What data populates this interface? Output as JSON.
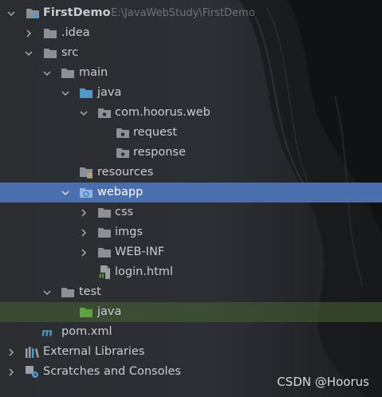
{
  "tree": {
    "project_name": "FirstDemo",
    "project_path": "E:\\JavaWebStudy\\FirstDemo",
    "idea_label": ".idea",
    "src_label": "src",
    "main_label": "main",
    "java_label": "java",
    "package_label": "com.hoorus.web",
    "request_label": "request",
    "response_label": "response",
    "resources_label": "resources",
    "webapp_label": "webapp",
    "css_label": "css",
    "imgs_label": "imgs",
    "webinf_label": "WEB-INF",
    "login_label": "login.html",
    "test_label": "test",
    "test_java_label": "java",
    "pom_label": "pom.xml",
    "ext_libs_label": "External Libraries",
    "scratches_label": "Scratches and Consoles"
  },
  "watermark": "CSDN @Hoorus",
  "colors": {
    "background": "#2b2d31",
    "selection": "#4b6eaf",
    "test_highlight": "#3b4a31",
    "folder": "#8c9096",
    "source_folder": "#4e9ac7",
    "test_folder": "#62a044"
  }
}
